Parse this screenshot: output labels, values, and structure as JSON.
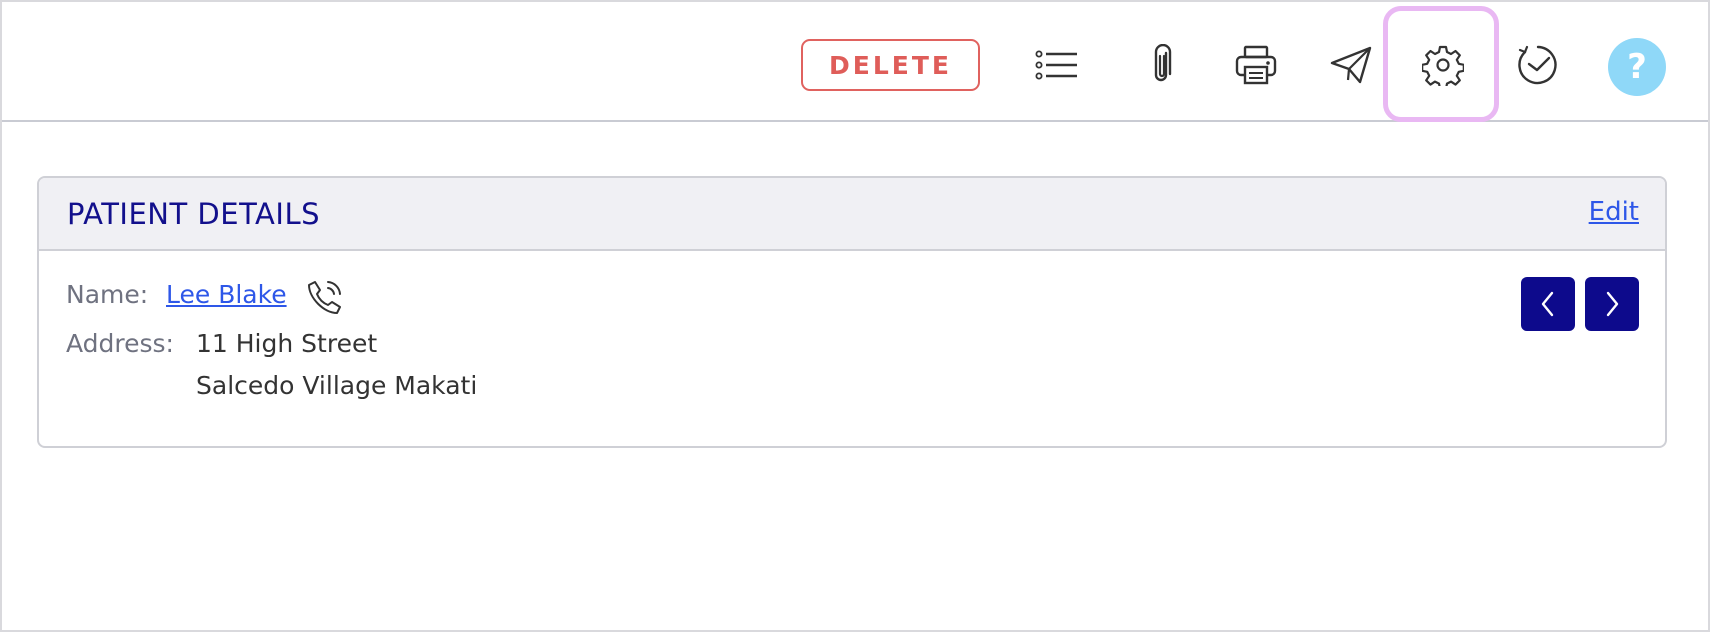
{
  "toolbar": {
    "delete_label": "DELETE",
    "icons": [
      "list-icon",
      "paperclip-icon",
      "printer-icon",
      "send-icon",
      "gear-icon",
      "history-icon",
      "help-icon"
    ],
    "help_label": "?",
    "highlighted": "gear-icon"
  },
  "patient_details": {
    "title": "PATIENT DETAILS",
    "edit_label": "Edit",
    "name_label": "Name:",
    "name_value": "Lee Blake",
    "address_label": "Address:",
    "address_line1": "11 High Street",
    "address_line2": "Salcedo Village Makati"
  },
  "colors": {
    "delete_red": "#df5d59",
    "title_navy": "#12108c",
    "link_blue": "#2e57e8",
    "nav_button_bg": "#0d0a8c",
    "help_bg": "#8fd8f8",
    "highlight_purple": "#e9b8f3"
  }
}
